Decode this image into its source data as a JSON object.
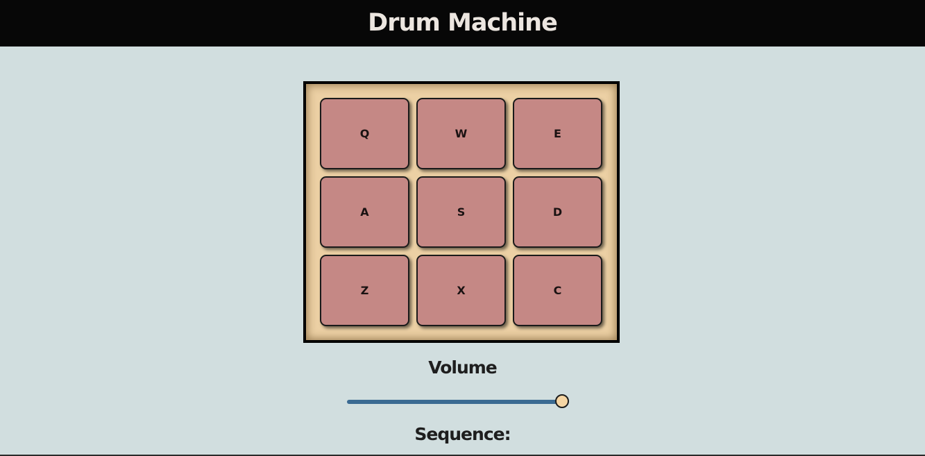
{
  "header": {
    "title": "Drum Machine"
  },
  "pads": [
    {
      "key": "Q"
    },
    {
      "key": "W"
    },
    {
      "key": "E"
    },
    {
      "key": "A"
    },
    {
      "key": "S"
    },
    {
      "key": "D"
    },
    {
      "key": "Z"
    },
    {
      "key": "X"
    },
    {
      "key": "C"
    }
  ],
  "volume": {
    "label": "Volume",
    "value_fraction": 0.97
  },
  "sequence": {
    "label": "Sequence:"
  },
  "colors": {
    "header_bg": "#070707",
    "page_bg": "#d1dedf",
    "pad_frame_bg": "#ecd0a4",
    "pad_bg": "#c58885",
    "slider_track": "#3a6a92",
    "slider_thumb": "#f6d6a4"
  }
}
